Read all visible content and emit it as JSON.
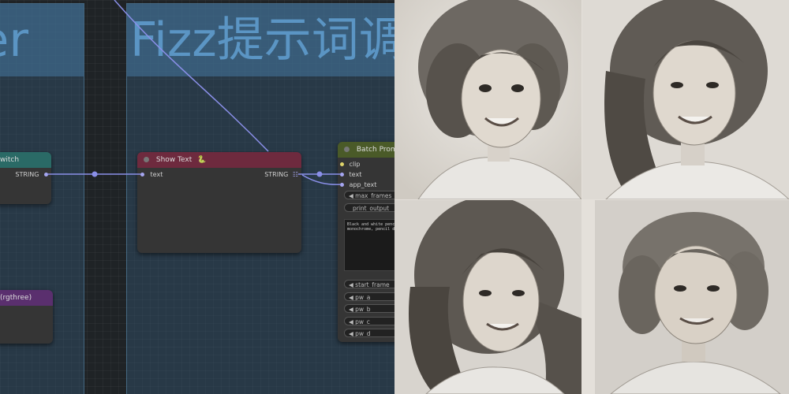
{
  "groups": [
    {
      "title": "er"
    },
    {
      "title": "Fizz提示词调"
    }
  ],
  "nodes": {
    "switch": {
      "title": "witch",
      "output": "STRING",
      "color": "#2a6a66"
    },
    "rgthree": {
      "title": "(rgthree)",
      "color": "#5a2f6e"
    },
    "show_text": {
      "title": "Show Text",
      "badge": "🐍",
      "input": "text",
      "output": "STRING",
      "color": "#6e2a3e"
    },
    "batch": {
      "title": "Batch Prompt",
      "color": "#4a5a28",
      "inputs": [
        "clip",
        "text",
        "app_text"
      ],
      "widgets": [
        "max_frames",
        "print_output"
      ],
      "text_value": "Black and white penc\nmonochrome, pencil d",
      "lower_widgets": [
        "start_frame",
        "pw_a",
        "pw_b",
        "pw_c",
        "pw_d"
      ]
    }
  },
  "photos": [
    {
      "label": "portrait-child"
    },
    {
      "label": "portrait-teen"
    },
    {
      "label": "portrait-young-woman"
    },
    {
      "label": "portrait-older-woman"
    }
  ],
  "colors": {
    "wire": "#8a8fe8",
    "accent": "#5b95c4"
  }
}
